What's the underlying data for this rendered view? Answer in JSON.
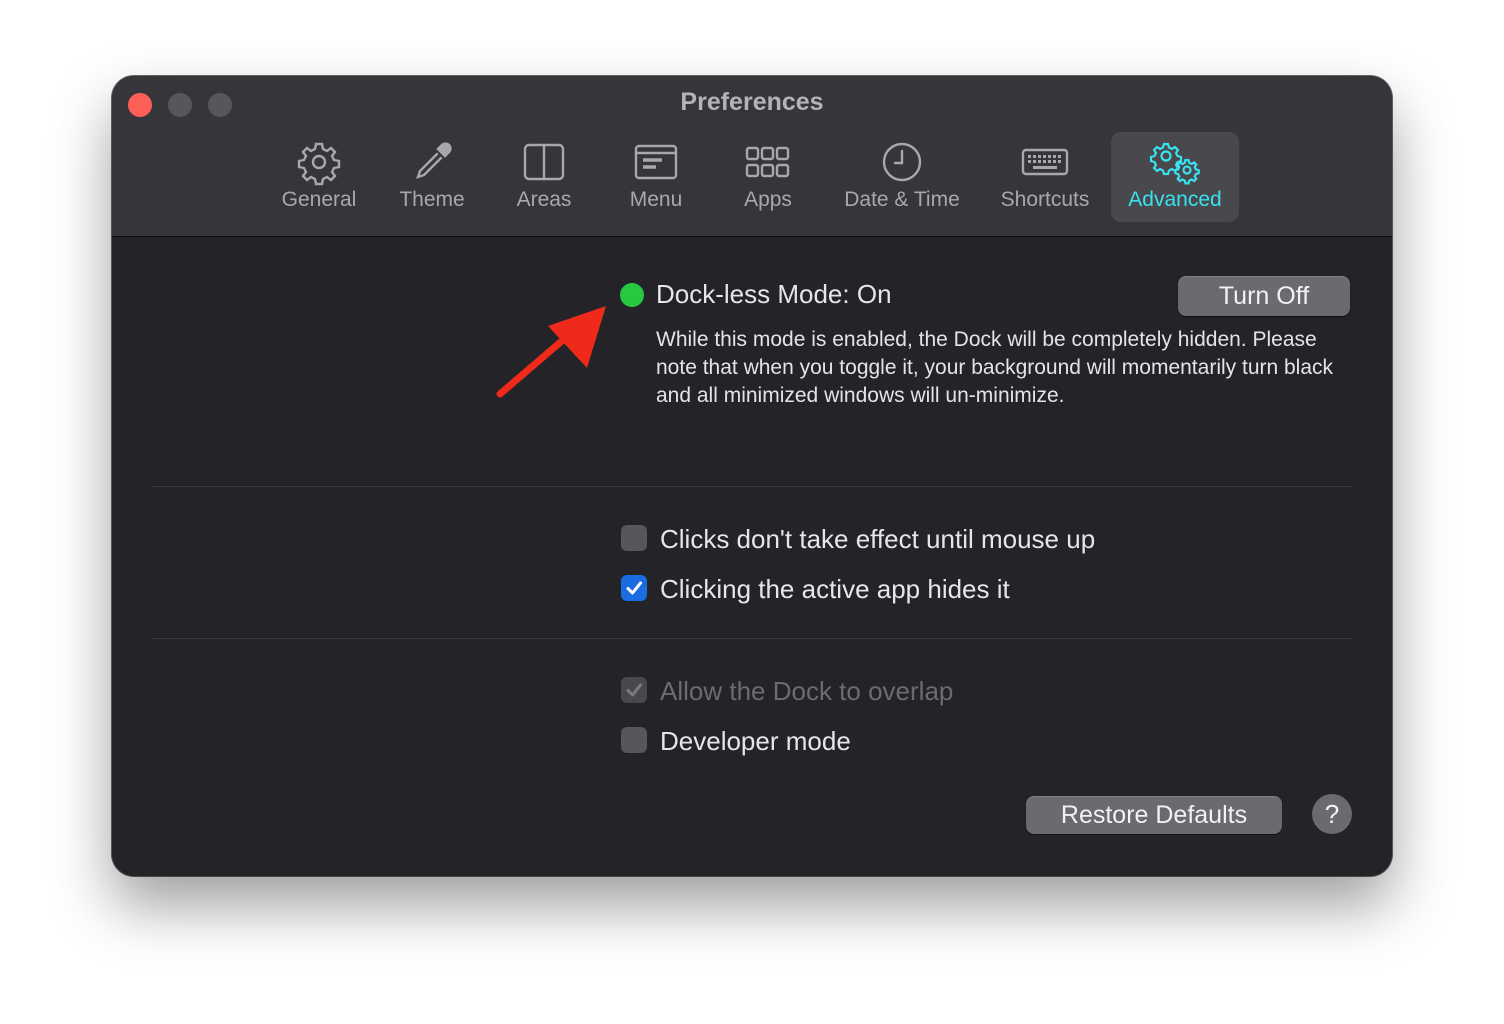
{
  "window": {
    "title": "Preferences"
  },
  "toolbar": {
    "tabs": [
      {
        "label": "General",
        "icon": "gear-icon"
      },
      {
        "label": "Theme",
        "icon": "eyedropper-icon"
      },
      {
        "label": "Areas",
        "icon": "split-areas-icon"
      },
      {
        "label": "Menu",
        "icon": "menu-icon"
      },
      {
        "label": "Apps",
        "icon": "apps-grid-icon"
      },
      {
        "label": "Date & Time",
        "icon": "clock-icon"
      },
      {
        "label": "Shortcuts",
        "icon": "keyboard-icon"
      },
      {
        "label": "Advanced",
        "icon": "gears-icon"
      }
    ],
    "active_tab": "Advanced",
    "accent_color": "#39e2ee"
  },
  "dockless": {
    "status_label": "Dock-less Mode: On",
    "status_color": "#27c93f",
    "button_label": "Turn Off",
    "description": "While this mode is enabled, the Dock will be completely hidden. Please note that when you toggle it, your background will momentarily turn black and all minimized windows will un-minimize."
  },
  "options_group1": [
    {
      "label": "Clicks don't take effect until mouse up",
      "checked": false
    },
    {
      "label": "Clicking the active app hides it",
      "checked": true
    }
  ],
  "options_group2": [
    {
      "label": "Allow the Dock to overlap",
      "checked": true,
      "disabled": true
    },
    {
      "label": "Developer mode",
      "checked": false
    }
  ],
  "footer": {
    "restore_label": "Restore Defaults",
    "help_label": "?"
  },
  "annotation": {
    "arrow_color": "#ef2a1b"
  }
}
